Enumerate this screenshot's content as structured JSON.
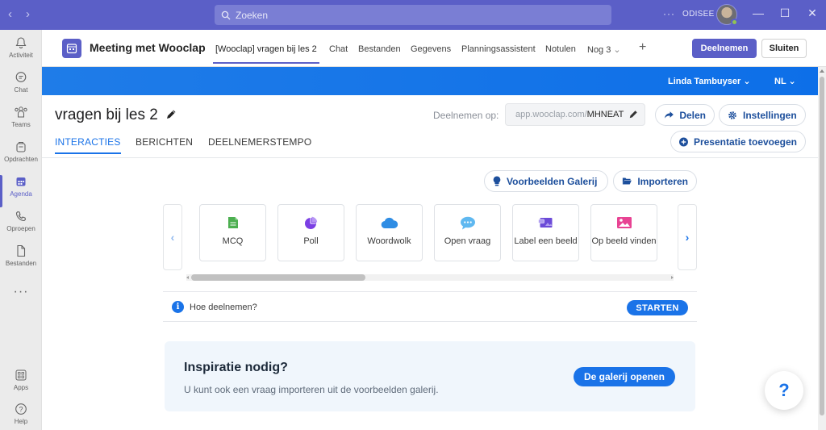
{
  "titlebar": {
    "back_glyph": "‹",
    "forward_glyph": "›",
    "search_placeholder": "Zoeken",
    "more_glyph": "···",
    "org": "ODISEE",
    "minimize_glyph": "—",
    "maximize_glyph": "☐",
    "close_glyph": "✕"
  },
  "rail": {
    "items": [
      {
        "label": "Activiteit",
        "icon": "bell-icon"
      },
      {
        "label": "Chat",
        "icon": "chat-icon"
      },
      {
        "label": "Teams",
        "icon": "teams-icon"
      },
      {
        "label": "Opdrachten",
        "icon": "assignments-icon"
      },
      {
        "label": "Agenda",
        "icon": "calendar-icon",
        "active": true
      },
      {
        "label": "Oproepen",
        "icon": "phone-icon"
      },
      {
        "label": "Bestanden",
        "icon": "file-icon"
      }
    ],
    "more_glyph": "···",
    "apps_label": "Apps",
    "help_label": "Help"
  },
  "meeting": {
    "title": "Meeting met Wooclap",
    "tabs": [
      {
        "label": "[Wooclap] vragen bij les 2",
        "active": true
      },
      {
        "label": "Chat"
      },
      {
        "label": "Bestanden"
      },
      {
        "label": "Gegevens"
      },
      {
        "label": "Planningsassistent"
      },
      {
        "label": "Notulen"
      },
      {
        "label": "Nog 3"
      }
    ],
    "add_tab_glyph": "+",
    "join_label": "Deelnemen",
    "close_label": "Sluiten"
  },
  "bluebar": {
    "user": "Linda Tambuyser",
    "lang": "NL"
  },
  "content": {
    "title": "vragen bij les 2",
    "join_label": "Deelnemen op:",
    "join_url": "app.wooclap.com/",
    "join_code": "MHNEAT",
    "share_label": "Delen",
    "settings_label": "Instellingen",
    "add_presentation_label": "Presentatie toevoegen",
    "tabs": [
      {
        "label": "INTERACTIES",
        "active": true
      },
      {
        "label": "BERICHTEN"
      },
      {
        "label": "DEELNEMERSTEMPO"
      }
    ],
    "gallery_label": "Voorbeelden Galerij",
    "import_label": "Importeren",
    "question_types": [
      {
        "label": "MCQ",
        "icon": "mcq-icon",
        "color": "#4caf50"
      },
      {
        "label": "Poll",
        "icon": "poll-icon",
        "color": "#7b3fe4"
      },
      {
        "label": "Woordwolk",
        "icon": "cloud-icon",
        "color": "#2f8de4"
      },
      {
        "label": "Open vraag",
        "icon": "speech-bubble-icon",
        "color": "#5fb8f0"
      },
      {
        "label": "Label een beeld",
        "icon": "label-image-icon",
        "color": "#6c4bd8"
      },
      {
        "label": "Op beeld vinden",
        "icon": "find-image-icon",
        "color": "#e84393"
      }
    ],
    "prev_glyph": "‹",
    "next_glyph": "›",
    "how_label": "Hoe deelnemen?",
    "start_label": "STARTEN",
    "inspiration_title": "Inspiratie nodig?",
    "inspiration_text": "U kunt ook een vraag importeren uit de voorbeelden galerij.",
    "open_gallery_label": "De galerij openen",
    "help_glyph": "?"
  },
  "colors": {
    "teams_purple": "#5b5fc7",
    "wooclap_blue": "#1a73e8"
  }
}
